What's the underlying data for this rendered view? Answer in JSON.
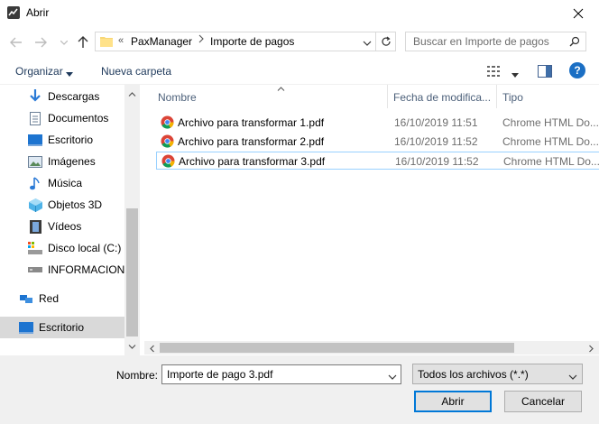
{
  "window": {
    "title": "Abrir"
  },
  "address": {
    "overflow": "«",
    "crumbs": [
      "PaxManager",
      "Importe de pagos"
    ]
  },
  "search": {
    "placeholder": "Buscar en Importe de pagos"
  },
  "toolbar": {
    "organize_label": "Organizar",
    "new_folder_label": "Nueva carpeta"
  },
  "sidebar": {
    "items": [
      {
        "label": "Descargas",
        "icon": "download-icon"
      },
      {
        "label": "Documentos",
        "icon": "documents-icon"
      },
      {
        "label": "Escritorio",
        "icon": "desktop-icon"
      },
      {
        "label": "Imágenes",
        "icon": "pictures-icon"
      },
      {
        "label": "Música",
        "icon": "music-icon"
      },
      {
        "label": "Objetos 3D",
        "icon": "objects-3d-icon"
      },
      {
        "label": "Vídeos",
        "icon": "videos-icon"
      },
      {
        "label": "Disco local (C:)",
        "icon": "local-disk-icon"
      },
      {
        "label": "INFORMACION",
        "icon": "drive-icon"
      },
      {
        "label": "Red",
        "icon": "network-icon"
      },
      {
        "label": "Escritorio",
        "icon": "desktop-icon"
      }
    ]
  },
  "columns": {
    "name": "Nombre",
    "date": "Fecha de modifica...",
    "type": "Tipo"
  },
  "files": [
    {
      "name": "Archivo para transformar 1.pdf",
      "date": "16/10/2019 11:51",
      "type": "Chrome HTML Do..."
    },
    {
      "name": "Archivo para transformar 2.pdf",
      "date": "16/10/2019 11:52",
      "type": "Chrome HTML Do..."
    },
    {
      "name": "Archivo para transformar 3.pdf",
      "date": "16/10/2019 11:52",
      "type": "Chrome HTML Do..."
    }
  ],
  "footer": {
    "name_label": "Nombre:",
    "filename_value": "Importe de pago 3.pdf",
    "filter_value": "Todos los archivos (*.*)",
    "open_label": "Abrir",
    "cancel_label": "Cancelar"
  },
  "colors": {
    "accent": "#0078d7",
    "selection_border": "#99d1ff",
    "sidebar_selected": "#d9d9d9",
    "help": "#1b6fc4"
  }
}
